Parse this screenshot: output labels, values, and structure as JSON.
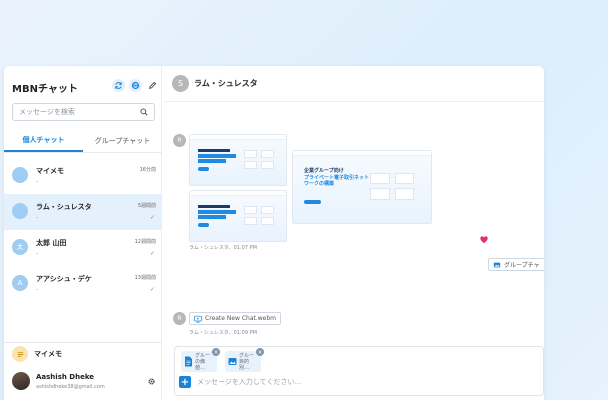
{
  "sidebar": {
    "title": "MBNチャット",
    "search_placeholder": "メッセージを検索",
    "tabs": [
      {
        "label": "個人チャット",
        "active": true
      },
      {
        "label": "グループチャット",
        "active": false
      }
    ],
    "chats": [
      {
        "name": "マイメモ",
        "preview": "-",
        "time": "16分前",
        "avatar_text": ""
      },
      {
        "name": "ラム・シュレスタ",
        "preview": "-",
        "time": "5週間前",
        "avatar_text": ""
      },
      {
        "name": "太郎 山田",
        "preview": "-",
        "time": "12週間前",
        "avatar_text": "太"
      },
      {
        "name": "アアシシュ・デケ",
        "preview": "-",
        "time": "13週間前",
        "avatar_text": "A"
      }
    ],
    "memo_label": "マイメモ",
    "user": {
      "name": "Aashish Dheke",
      "email": "ashishdheke38@gmail.com"
    }
  },
  "conversation": {
    "title": "ラム・シュレスタ",
    "avatar_text": "S",
    "messages": [
      {
        "avatar_text": "R",
        "meta": "ラム・シュレスタ、01:07 PM"
      },
      {
        "avatar_text": "R",
        "file_name": "Create New Chat.webm",
        "meta": "ラム・シュレスタ、01:09 PM"
      }
    ],
    "right_file_label": "グループチャ",
    "thumb_heading": "企業グループ向け",
    "thumb_headline": "プライベート電子取引ネットワークの構築",
    "composer": {
      "attachments": [
        {
          "label_line1": "グルー",
          "label_line2": "の価値…"
        },
        {
          "label_line1": "グルー",
          "label_line2": "目的別…"
        }
      ],
      "placeholder": "メッセージを入力してください..."
    }
  }
}
